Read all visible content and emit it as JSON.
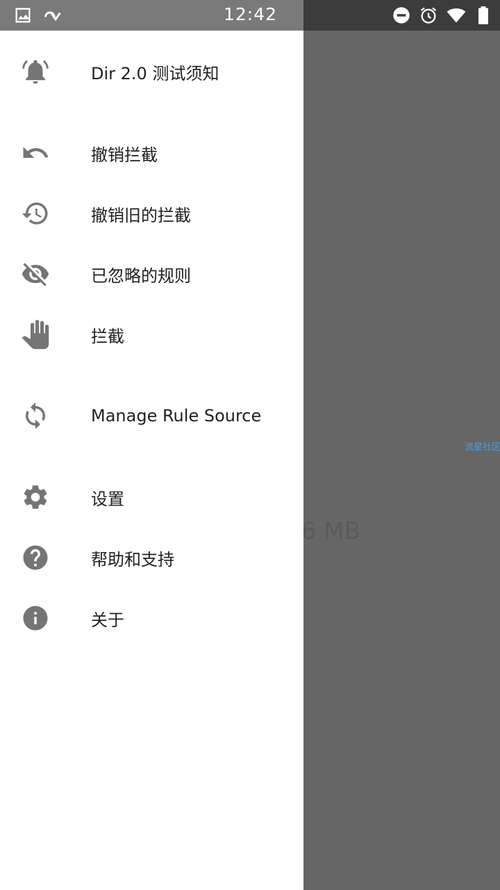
{
  "status_bar": {
    "time": "12:42",
    "left_icons": [
      "image-icon",
      "cast-icon"
    ],
    "right_icons": [
      "do-not-disturb-icon",
      "alarm-icon",
      "wifi-icon",
      "battery-icon"
    ]
  },
  "background": {
    "link_text": "流星社区",
    "size_text": ".6 MB"
  },
  "drawer": {
    "items": [
      {
        "label": "Dir 2.0 测试须知",
        "icon": "notification-bell-icon"
      },
      {
        "label": "撤销拦截",
        "icon": "undo-icon"
      },
      {
        "label": "撤销旧的拦截",
        "icon": "history-icon"
      },
      {
        "label": "已忽略的规则",
        "icon": "visibility-off-icon"
      },
      {
        "label": "拦截",
        "icon": "hand-block-icon"
      },
      {
        "label": "Manage Rule Source",
        "icon": "sync-icon"
      },
      {
        "label": "设置",
        "icon": "gear-icon"
      },
      {
        "label": "帮助和支持",
        "icon": "help-icon"
      },
      {
        "label": "关于",
        "icon": "info-icon"
      }
    ]
  },
  "colors": {
    "icon": "#757575",
    "text": "#212121",
    "scrim": "#666666",
    "link": "#4a9ee6"
  }
}
